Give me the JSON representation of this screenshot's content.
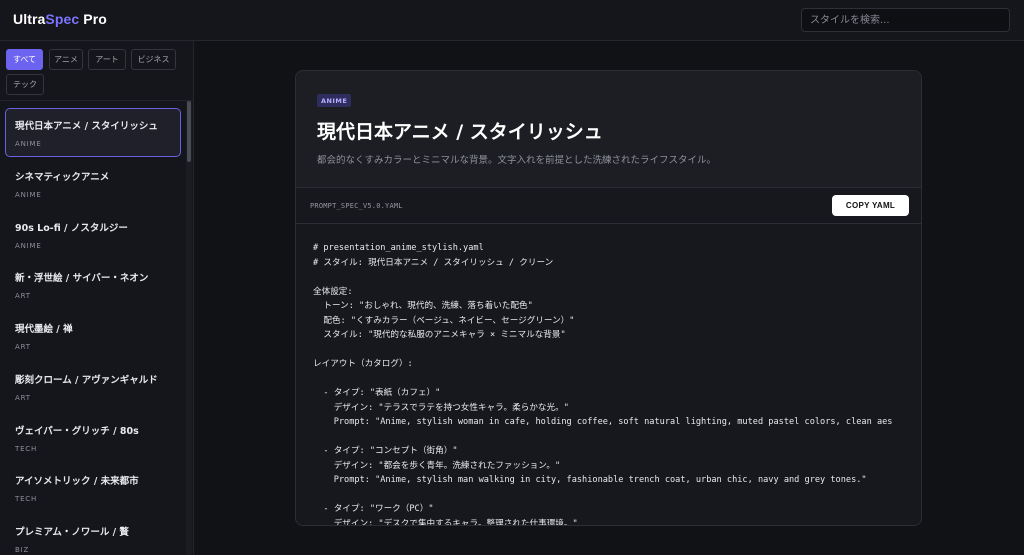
{
  "header": {
    "logo_prefix": "Ultra",
    "logo_accent": "Spec",
    "logo_suffix": " Pro",
    "search_placeholder": "スタイルを検索..."
  },
  "filters": [
    "すべて",
    "アニメ",
    "アート",
    "ビジネス",
    "テック"
  ],
  "active_filter": "すべて",
  "styles": [
    {
      "name": "現代日本アニメ / スタイリッシュ",
      "category": "ANIME",
      "active": true
    },
    {
      "name": "シネマティックアニメ",
      "category": "ANIME"
    },
    {
      "name": "90s Lo-fi / ノスタルジー",
      "category": "ANIME"
    },
    {
      "name": "新・浮世絵 / サイバー・ネオン",
      "category": "ART"
    },
    {
      "name": "現代墨絵 / 禅",
      "category": "ART"
    },
    {
      "name": "彫刻クローム / アヴァンギャルド",
      "category": "ART"
    },
    {
      "name": "ヴェイパー・グリッチ / 80s",
      "category": "TECH"
    },
    {
      "name": "アイソメトリック / 未来都市",
      "category": "TECH"
    },
    {
      "name": "プレミアム・ノワール / 贅",
      "category": "BIZ"
    }
  ],
  "detail": {
    "badge": "ANIME",
    "title": "現代日本アニメ / スタイリッシュ",
    "description": "都会的なくすみカラーとミニマルな背景。文字入れを前提とした洗練されたライフスタイル。",
    "file_name": "PROMPT_SPEC_V5.0.YAML",
    "copy_label": "COPY YAML",
    "code_lines": [
      "# presentation_anime_stylish.yaml",
      "# スタイル: 現代日本アニメ / スタイリッシュ / クリーン",
      "",
      "全体設定:",
      "  トーン: \"おしゃれ、現代的、洗練、落ち着いた配色\"",
      "  配色: \"くすみカラー（ベージュ、ネイビー、セージグリーン）\"",
      "  スタイル: \"現代的な私服のアニメキャラ × ミニマルな背景\"",
      "",
      "レイアウト（カタログ）:",
      "",
      "  - タイプ: \"表紙（カフェ）\"",
      "    デザイン: \"テラスでラテを持つ女性キャラ。柔らかな光。\"",
      "    Prompt: \"Anime, stylish woman in cafe, holding coffee, soft natural lighting, muted pastel colors, clean aes",
      "",
      "  - タイプ: \"コンセプト（街角）\"",
      "    デザイン: \"都会を歩く青年。洗練されたファッション。\"",
      "    Prompt: \"Anime, stylish man walking in city, fashionable trench coat, urban chic, navy and grey tones.\"",
      "",
      "  - タイプ: \"ワーク（PC）\"",
      "    デザイン: \"デスクで集中するキャラ。整理された仕事環境。\""
    ]
  }
}
